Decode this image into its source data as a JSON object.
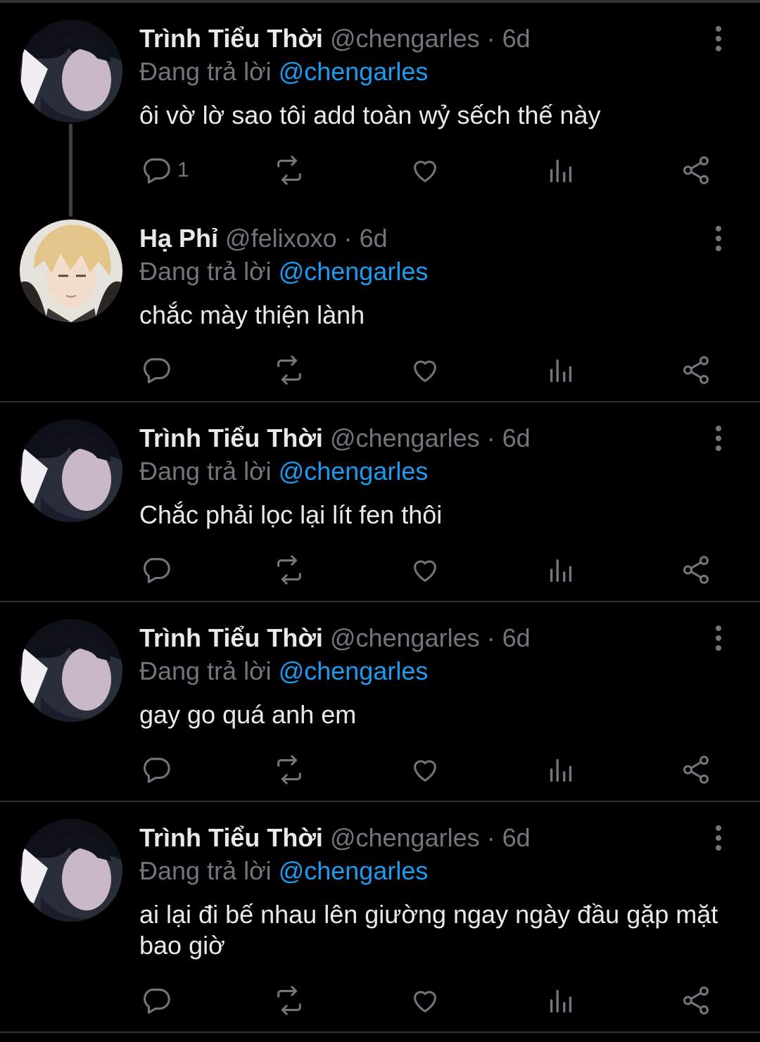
{
  "replying_prefix": "Đang trả lời",
  "tweets": [
    {
      "author_name": "Trình Tiểu Thời",
      "author_handle": "@chengarles",
      "separator": "·",
      "time": "6d",
      "replying_to": "@chengarles",
      "text": "ôi vờ lờ sao tôi add toàn wỷ sếch thế này",
      "reply_count": "1",
      "avatar": "dark-hair-character"
    },
    {
      "author_name": "Hạ Phỉ",
      "author_handle": "@felixoxo",
      "separator": "·",
      "time": "6d",
      "replying_to": "@chengarles",
      "text": "chắc mày thiện lành",
      "reply_count": "",
      "avatar": "blond-hair-character"
    },
    {
      "author_name": "Trình Tiểu Thời",
      "author_handle": "@chengarles",
      "separator": "·",
      "time": "6d",
      "replying_to": "@chengarles",
      "text": "Chắc phải lọc lại lít fen thôi",
      "reply_count": "",
      "avatar": "dark-hair-character"
    },
    {
      "author_name": "Trình Tiểu Thời",
      "author_handle": "@chengarles",
      "separator": "·",
      "time": "6d",
      "replying_to": "@chengarles",
      "text": "gay go quá anh em",
      "reply_count": "",
      "avatar": "dark-hair-character"
    },
    {
      "author_name": "Trình Tiểu Thời",
      "author_handle": "@chengarles",
      "separator": "·",
      "time": "6d",
      "replying_to": "@chengarles",
      "text": "ai lại đi bế nhau lên giường ngay ngày đầu gặp mặt bao giờ",
      "reply_count": "",
      "avatar": "dark-hair-character"
    }
  ],
  "icons": [
    "reply-icon",
    "retweet-icon",
    "like-icon",
    "views-icon",
    "share-icon",
    "more-icon"
  ],
  "colors": {
    "background": "#000000",
    "text": "#e7e9ea",
    "secondary": "#71767b",
    "link": "#1d9bf0",
    "divider": "#2f3336"
  }
}
